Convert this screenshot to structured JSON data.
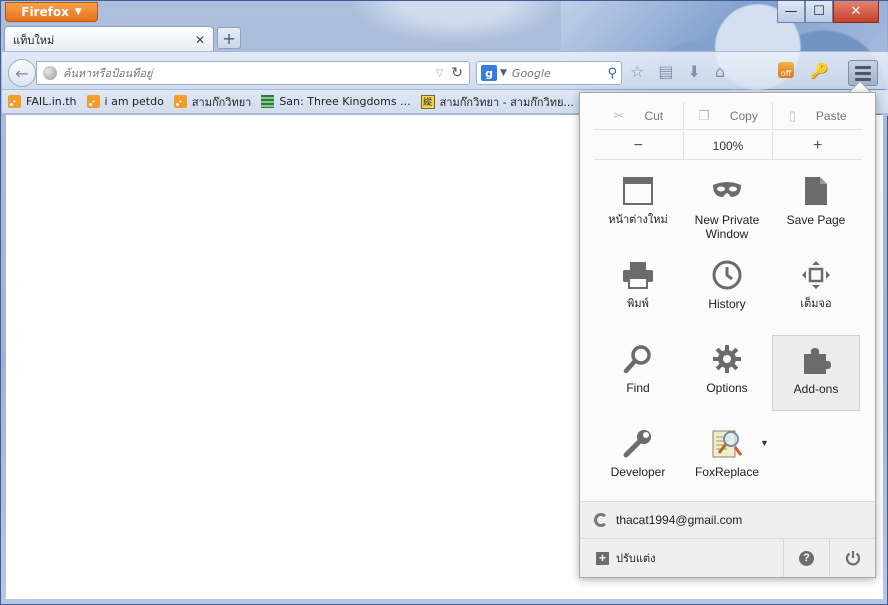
{
  "window": {
    "app_button": "Firefox",
    "controls": {
      "minimize": "—",
      "maximize": "☐",
      "close": "✕"
    }
  },
  "tabs": [
    {
      "label": "แท็บใหม่"
    }
  ],
  "navbar": {
    "url_placeholder": "ค้นหาหรือป้อนที่อยู่",
    "search_placeholder": "Google"
  },
  "bookmarks": [
    {
      "label": "FAIL.in.th",
      "icon": "rss-icon"
    },
    {
      "label": "i am petdo",
      "icon": "rss-icon"
    },
    {
      "label": "สามก๊กวิทยา",
      "icon": "rss-icon"
    },
    {
      "label": "San: Three Kingdoms ...",
      "icon": "stack-icon"
    },
    {
      "label": "สามก๊กวิทยา - สามก๊กวิทย...",
      "icon": "site-icon"
    }
  ],
  "menu_panel": {
    "edit": {
      "cut": "Cut",
      "copy": "Copy",
      "paste": "Paste"
    },
    "zoom": {
      "minus": "−",
      "level": "100%",
      "plus": "+"
    },
    "items": {
      "new_window": "หน้าต่างใหม่",
      "private_window": "New Private Window",
      "save_page": "Save Page",
      "print": "พิมพ์",
      "history": "History",
      "fullscreen": "เต็มจอ",
      "find": "Find",
      "options": "Options",
      "addons": "Add-ons",
      "developer": "Developer",
      "foxreplace": "FoxReplace"
    },
    "account": "thacat1994@gmail.com",
    "customize": "ปรับแต่ง"
  }
}
